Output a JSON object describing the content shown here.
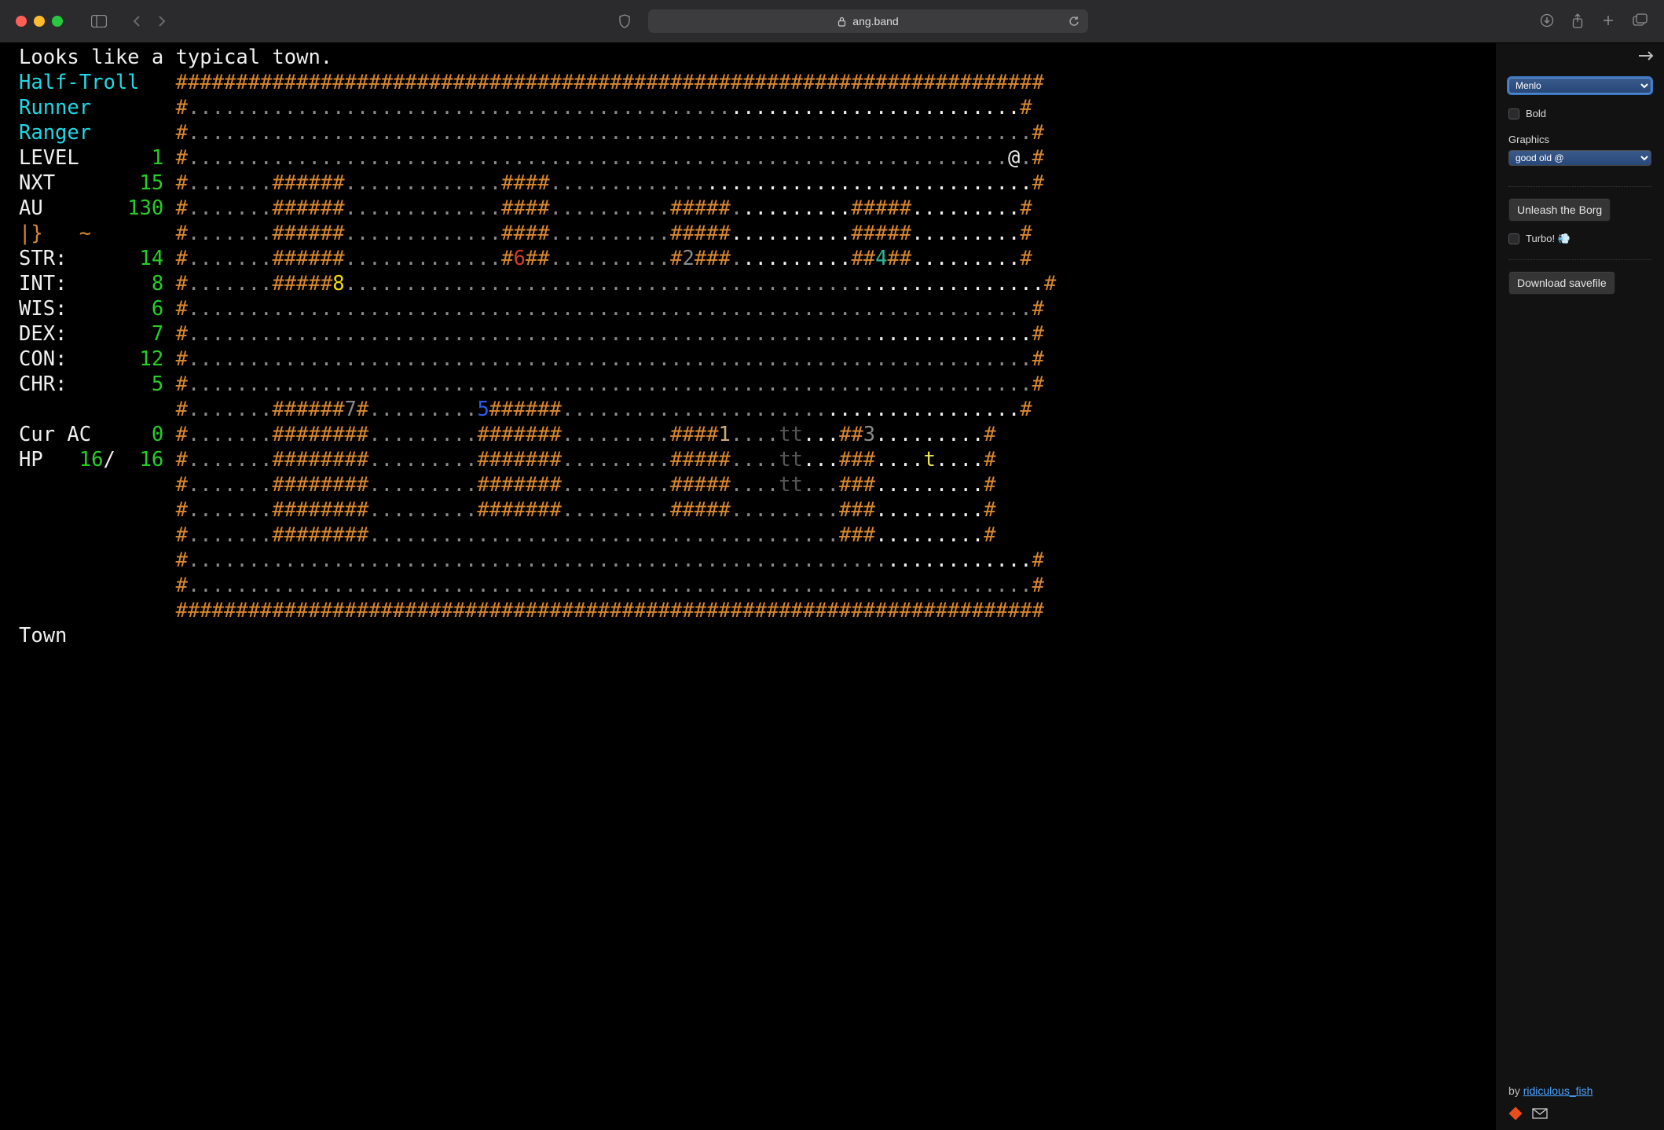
{
  "browser": {
    "url": "ang.band"
  },
  "game": {
    "message": "Looks like a typical town.",
    "race": "Half-Troll",
    "name": "Runner",
    "class": "Ranger",
    "stats_labels": {
      "level": "LEVEL",
      "nxt": "NXT",
      "au": "AU",
      "str": "STR:",
      "int": "INT:",
      "wis": "WIS:",
      "dex": "DEX:",
      "con": "CON:",
      "chr": "CHR:",
      "curac": "Cur AC",
      "hp": "HP"
    },
    "stats": {
      "level": "1",
      "nxt": "15",
      "au": "130",
      "equip": "|}   ~",
      "str": "14",
      "int": "8",
      "wis": "6",
      "dex": "7",
      "con": "12",
      "chr": "5",
      "curac": "0",
      "hp_cur": "16",
      "hp_max": "16"
    },
    "depth": "Town",
    "map_symbols": {
      "player": "@",
      "shop2": "2",
      "shop3": "3",
      "shop4": "4",
      "shop5": "5",
      "shop6": "6",
      "shop7": "7",
      "shop8": "8",
      "shop1": "1",
      "townsfolk": "t"
    }
  },
  "sidebar": {
    "font": "Menlo",
    "bold_label": "Bold",
    "graphics_label": "Graphics",
    "graphics_value": "good old @",
    "borg_button": "Unleash the Borg",
    "turbo_label": "Turbo! 💨",
    "download_button": "Download savefile",
    "credit_prefix": "by ",
    "credit_name": "ridiculous_fish"
  }
}
